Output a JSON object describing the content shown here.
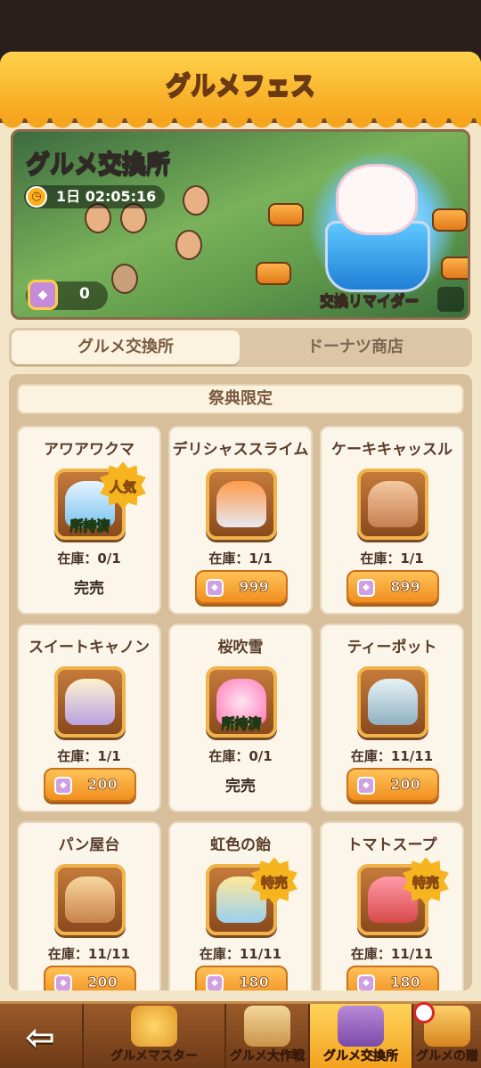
{
  "header": {
    "title": "グルメフェス"
  },
  "banner": {
    "title": "グルメ交換所",
    "timer": "1日 02:05:16",
    "currency_value": "0",
    "label": "交換リマイダー"
  },
  "tabs": [
    {
      "label": "グルメ交換所",
      "active": true
    },
    {
      "label": "ドーナツ商店",
      "active": false
    }
  ],
  "section_title": "祭典限定",
  "items": [
    {
      "name": "アワアワクマ",
      "badge": "人気",
      "owned_label": "所持済",
      "stock": "在庫：0/1",
      "status": "完売",
      "price": ""
    },
    {
      "name": "デリシャススライム",
      "badge": "",
      "owned_label": "",
      "stock": "在庫：1/1",
      "status": "",
      "price": "999"
    },
    {
      "name": "ケーキキャッスル",
      "badge": "",
      "owned_label": "",
      "stock": "在庫：1/1",
      "status": "",
      "price": "899"
    },
    {
      "name": "スイートキャノン",
      "badge": "",
      "owned_label": "",
      "stock": "在庫：1/1",
      "status": "",
      "price": "200"
    },
    {
      "name": "桜吹雪",
      "badge": "",
      "owned_label": "所持済",
      "stock": "在庫：0/1",
      "status": "完売",
      "price": ""
    },
    {
      "name": "ティーポット",
      "badge": "",
      "owned_label": "",
      "stock": "在庫：11/11",
      "status": "",
      "price": "200"
    },
    {
      "name": "パン屋台",
      "badge": "",
      "owned_label": "",
      "stock": "在庫：11/11",
      "status": "",
      "price": "200"
    },
    {
      "name": "虹色の飴",
      "badge": "特売",
      "owned_label": "",
      "stock": "在庫：11/11",
      "status": "",
      "price": "180"
    },
    {
      "name": "トマトスープ",
      "badge": "特売",
      "owned_label": "",
      "stock": "在庫：11/11",
      "status": "",
      "price": "180"
    }
  ],
  "bottom_nav": {
    "back_icon": "back-arrow-icon",
    "items": [
      {
        "label": "グルメマスター",
        "active": false
      },
      {
        "label": "グルメ大作戦",
        "active": false
      },
      {
        "label": "グルメ交換所",
        "active": true
      },
      {
        "label": "グルメの贈",
        "active": false
      }
    ]
  },
  "colors": {
    "accent": "#f6a51e",
    "panel": "#f3e5c8",
    "owned_text": "#c8ff6a",
    "badge": "#f6b51f"
  }
}
